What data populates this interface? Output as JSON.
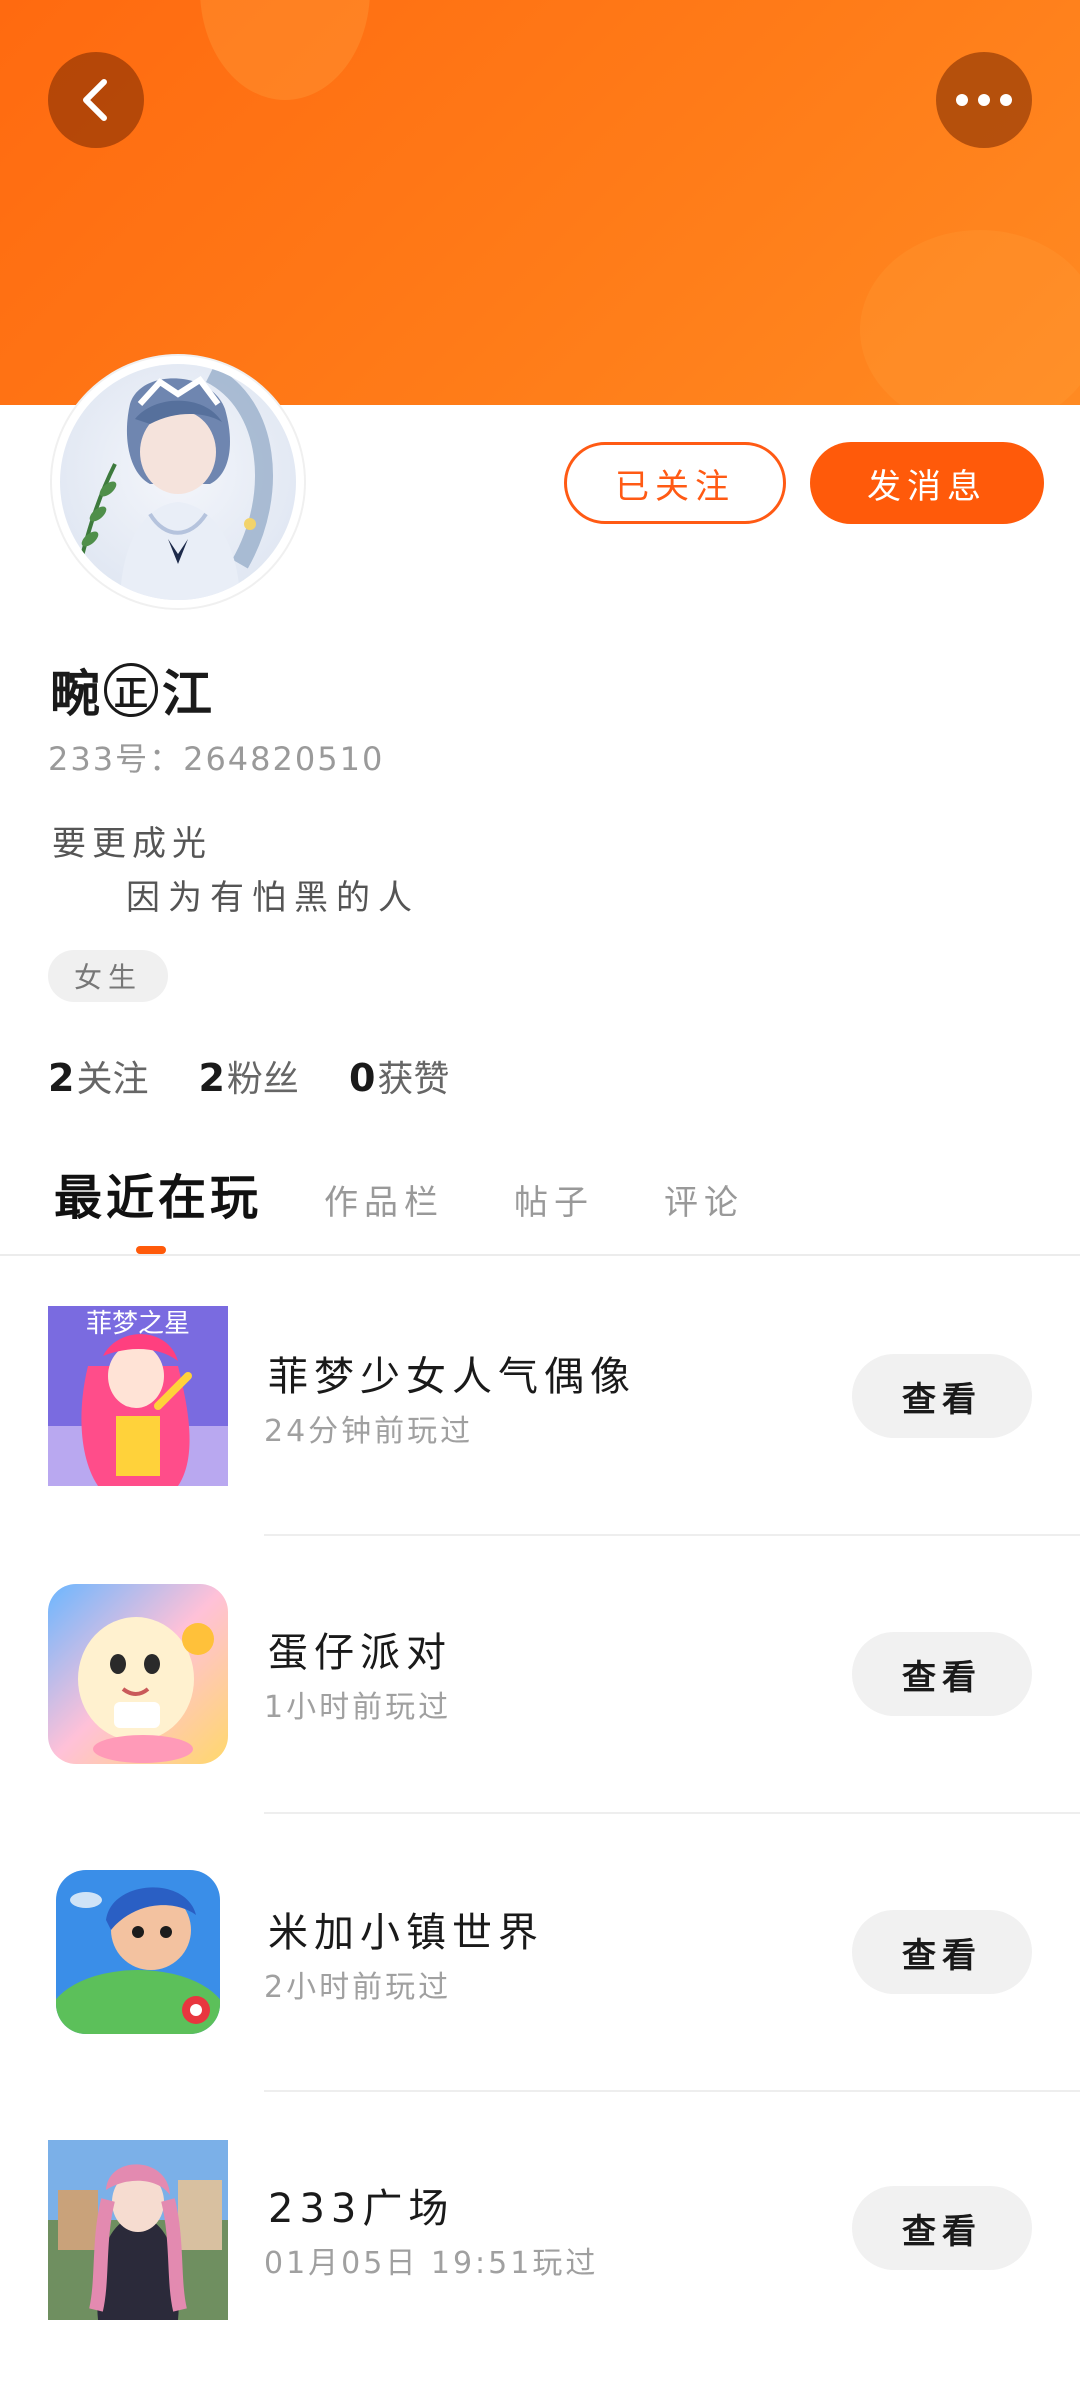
{
  "profile": {
    "following_button": "已关注",
    "message_button": "发消息",
    "username": "畹",
    "username_badge": "正",
    "username_suffix": "江",
    "uid": "233号：264820510",
    "bio_line1": "要更成光",
    "bio_line2": "因为有怕黑的人",
    "gender_tag": "女生"
  },
  "stats": [
    {
      "num": "2",
      "label": "关注"
    },
    {
      "num": "2",
      "label": "粉丝"
    },
    {
      "num": "0",
      "label": "获赞"
    }
  ],
  "tabs": [
    {
      "label": "最近在玩",
      "active": true
    },
    {
      "label": "作品栏",
      "active": false
    },
    {
      "label": "帖子",
      "active": false
    },
    {
      "label": "评论",
      "active": false
    }
  ],
  "games": [
    {
      "name": "菲梦少女人气偶像",
      "time": "24分钟前玩过",
      "button": "查看",
      "icon_text": "菲梦之星"
    },
    {
      "name": "蛋仔派对",
      "time": "1小时前玩过",
      "button": "查看"
    },
    {
      "name": "米加小镇世界",
      "time": "2小时前玩过",
      "button": "查看"
    },
    {
      "name": "233广场",
      "time": "01月05日 19:51玩过",
      "button": "查看"
    }
  ],
  "colors": {
    "accent": "#ff5a0a",
    "banner": "#ff7414"
  }
}
